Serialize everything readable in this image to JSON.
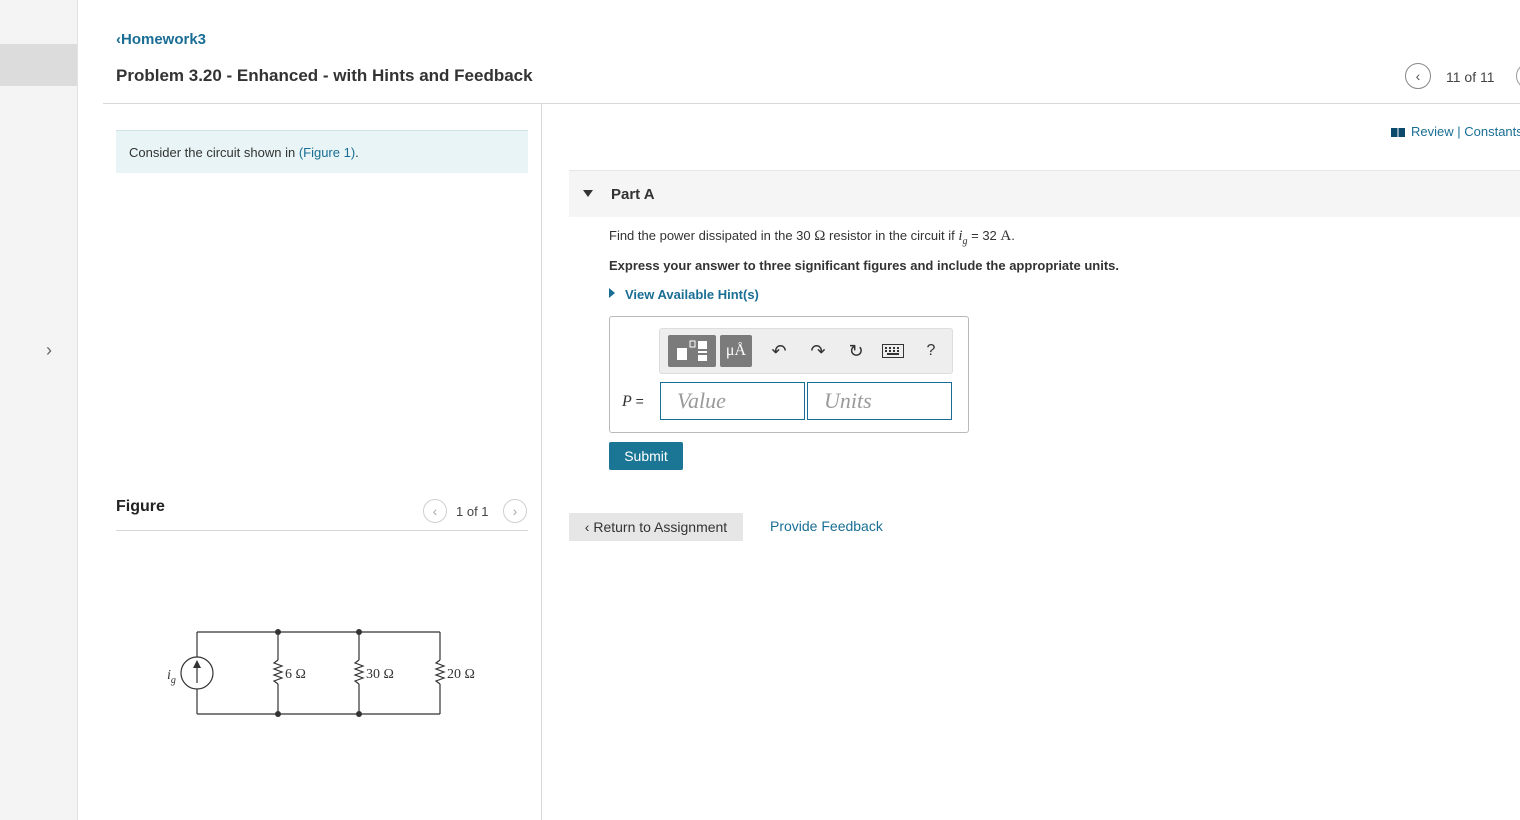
{
  "nav": {
    "back_label": "Homework3",
    "problem_title": "Problem 3.20 - Enhanced - with Hints and Feedback",
    "problem_counter": "11 of 11"
  },
  "intro": {
    "text_before": "Consider the circuit shown in ",
    "figure_link": "(Figure 1)",
    "text_after": "."
  },
  "figure": {
    "label": "Figure",
    "counter": "1 of 1",
    "circuit": {
      "source_label": "i",
      "source_subscript": "g",
      "resistors": [
        "6 Ω",
        "30 Ω",
        "20 Ω"
      ]
    }
  },
  "header_links": {
    "review": "Review",
    "separator": " | ",
    "constants": "Constants"
  },
  "part": {
    "title": "Part A",
    "question_prefix": "Find the power dissipated in the 30 ",
    "question_ohm": "Ω",
    "question_mid": " resistor in the circuit if ",
    "question_var": "i",
    "question_sub": "g",
    "question_eq": " = 32 ",
    "question_unit": "A",
    "question_end": ".",
    "instruction": "Express your answer to three significant figures and include the appropriate units.",
    "hint_label": "View Available Hint(s)"
  },
  "answer": {
    "variable": "P",
    "equals": " =",
    "value_placeholder": "Value",
    "units_placeholder": "Units",
    "units_button": "μÅ",
    "help_button": "?"
  },
  "buttons": {
    "submit": "Submit",
    "return": "Return to Assignment",
    "feedback": "Provide Feedback"
  },
  "icons": {
    "templates": "templates-icon",
    "units": "units-icon",
    "undo": "undo-icon",
    "redo": "redo-icon",
    "reset": "reset-icon",
    "keyboard": "keyboard-icon",
    "help": "help-icon"
  },
  "colors": {
    "link": "#1a6e95",
    "submit_bg": "#1b7595",
    "intro_bg": "#e8f4f5"
  }
}
